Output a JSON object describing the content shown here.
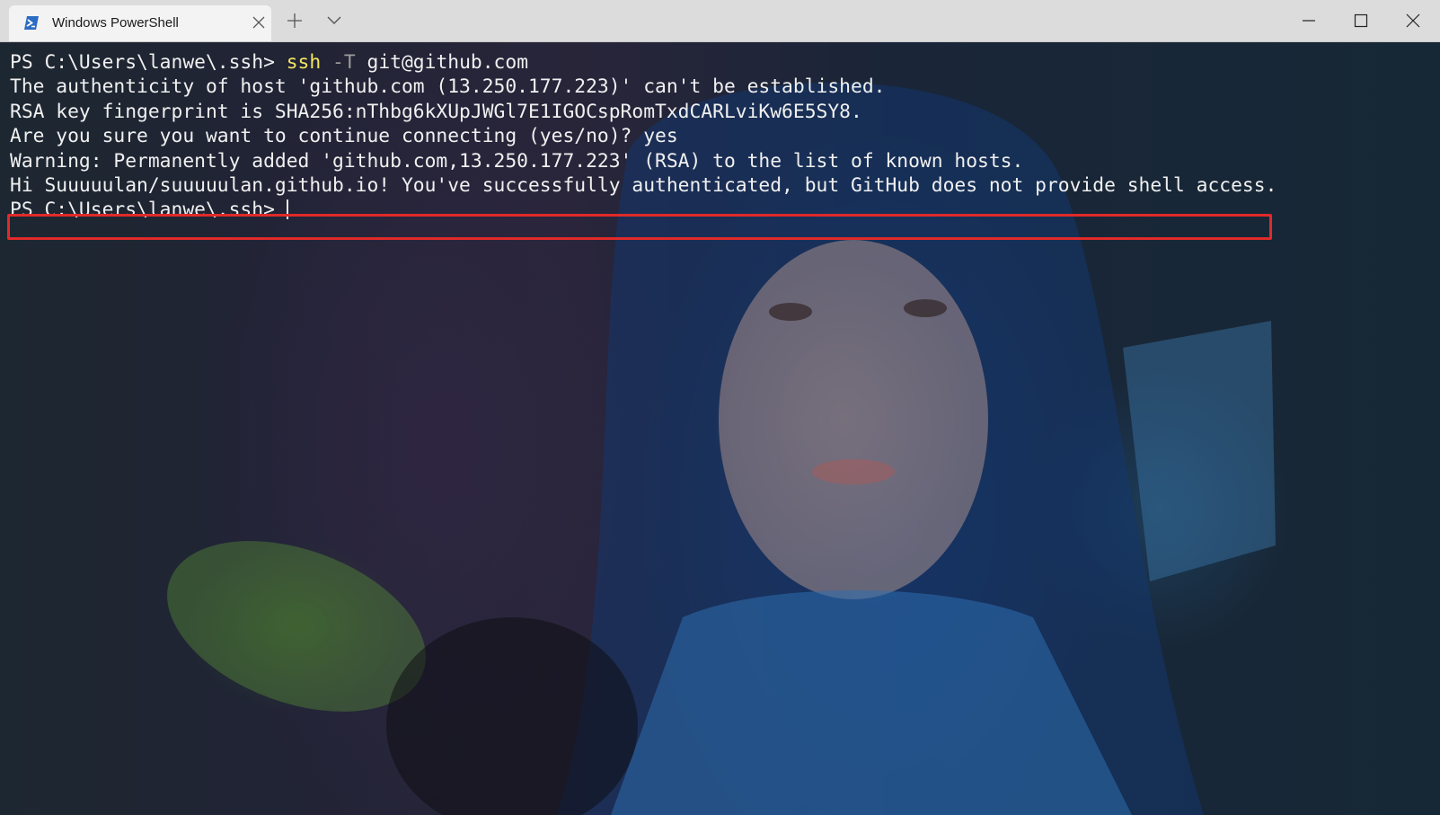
{
  "window": {
    "tab_title": "Windows PowerShell",
    "tab_icon": "powershell-icon",
    "controls": [
      "minimize-icon",
      "maximize-icon",
      "close-icon"
    ]
  },
  "terminal": {
    "prompt": "PS C:\\Users\\lanwe\\.ssh> ",
    "command": {
      "program": "ssh",
      "flag": "-T",
      "argument": "git@github.com"
    },
    "output": [
      "The authenticity of host 'github.com (13.250.177.223)' can't be established.",
      "RSA key fingerprint is SHA256:nThbg6kXUpJWGl7E1IGOCspRomTxdCARLviKw6E5SY8.",
      "Are you sure you want to continue connecting (yes/no)? yes",
      "Warning: Permanently added 'github.com,13.250.177.223' (RSA) to the list of known hosts.",
      "Hi Suuuuulan/suuuuulan.github.io! You've successfully authenticated, but GitHub does not provide shell access."
    ],
    "final_prompt": "PS C:\\Users\\lanwe\\.ssh>",
    "highlighted_line_index": 4
  },
  "colors": {
    "command_highlight": "#f5e663",
    "flag_color": "#9a9a9a",
    "text_color": "#f0f0f0",
    "annotation_box": "#e02a2a",
    "titlebar": "#dcdcdc",
    "tab_active": "#f3f3f3"
  }
}
